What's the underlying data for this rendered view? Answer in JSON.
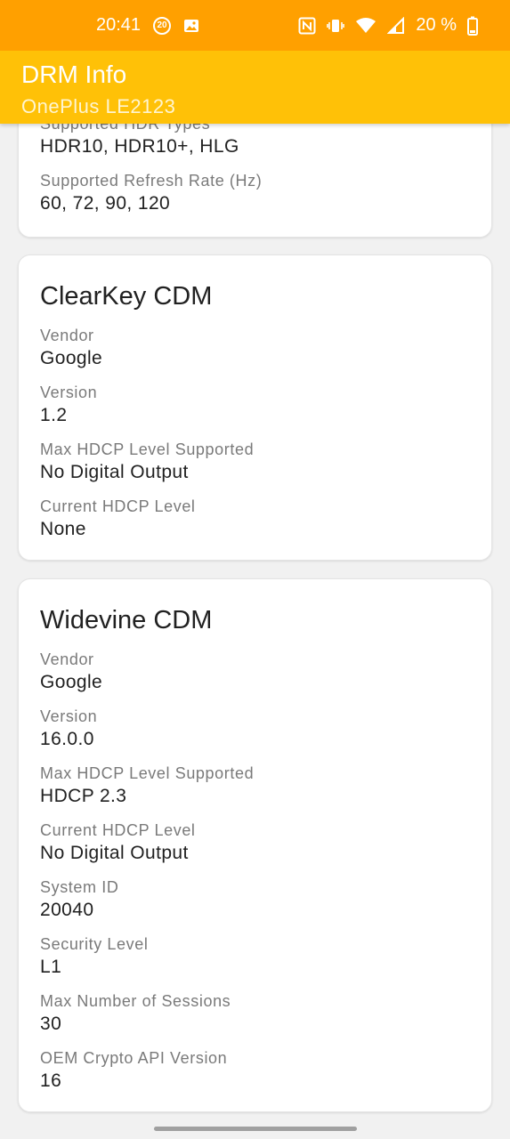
{
  "status_bar": {
    "time": "20:41",
    "notification_badge": "20",
    "battery_text": "20 %",
    "icons": [
      "notification-20-icon",
      "image-icon",
      "nfc-icon",
      "vibrate-icon",
      "wifi-icon",
      "signal-icon",
      "battery-icon"
    ]
  },
  "app_bar": {
    "title": "DRM Info",
    "subtitle": "OnePlus LE2123",
    "color": "#ffc107"
  },
  "display_card": {
    "fields": [
      {
        "label": "Supported HDR Types",
        "value": "HDR10, HDR10+, HLG"
      },
      {
        "label": "Supported Refresh Rate (Hz)",
        "value": "60, 72, 90, 120"
      }
    ]
  },
  "clearkey_card": {
    "title": "ClearKey CDM",
    "fields": [
      {
        "label": "Vendor",
        "value": "Google"
      },
      {
        "label": "Version",
        "value": "1.2"
      },
      {
        "label": "Max HDCP Level Supported",
        "value": "No Digital Output"
      },
      {
        "label": "Current HDCP Level",
        "value": "None"
      }
    ]
  },
  "widevine_card": {
    "title": "Widevine CDM",
    "fields": [
      {
        "label": "Vendor",
        "value": "Google"
      },
      {
        "label": "Version",
        "value": "16.0.0"
      },
      {
        "label": "Max HDCP Level Supported",
        "value": "HDCP 2.3"
      },
      {
        "label": "Current HDCP Level",
        "value": "No Digital Output"
      },
      {
        "label": "System ID",
        "value": "20040"
      },
      {
        "label": "Security Level",
        "value": "L1"
      },
      {
        "label": "Max Number of Sessions",
        "value": "30"
      },
      {
        "label": "OEM Crypto API Version",
        "value": "16"
      }
    ]
  }
}
